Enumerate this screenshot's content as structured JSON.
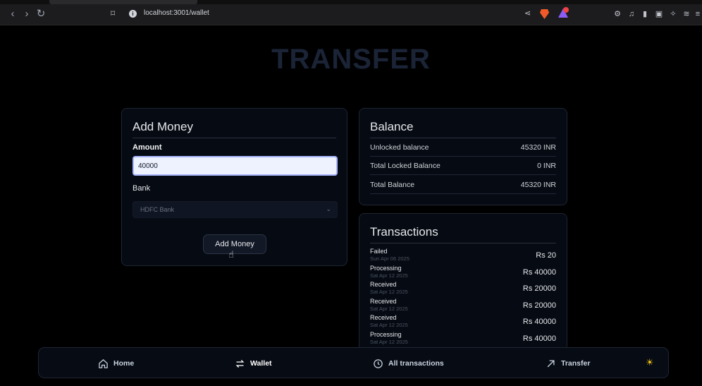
{
  "browser": {
    "url": "localhost:3001/wallet"
  },
  "page": {
    "title": "TRANSFER"
  },
  "add_money": {
    "title": "Add Money",
    "amount_label": "Amount",
    "amount_value": "40000",
    "bank_label": "Bank",
    "bank_selected": "HDFC Bank",
    "button_label": "Add Money"
  },
  "balance": {
    "title": "Balance",
    "rows": [
      {
        "label": "Unlocked balance",
        "value": "45320 INR"
      },
      {
        "label": "Total Locked Balance",
        "value": "0 INR"
      },
      {
        "label": "Total Balance",
        "value": "45320 INR"
      }
    ]
  },
  "transactions": {
    "title": "Transactions",
    "items": [
      {
        "status": "Failed",
        "date": "Sun Apr 06 2025",
        "amount": "Rs 20"
      },
      {
        "status": "Processing",
        "date": "Sat Apr 12 2025",
        "amount": "Rs 40000"
      },
      {
        "status": "Received",
        "date": "Sat Apr 12 2025",
        "amount": "Rs 20000"
      },
      {
        "status": "Received",
        "date": "Sat Apr 12 2025",
        "amount": "Rs 20000"
      },
      {
        "status": "Received",
        "date": "Sat Apr 12 2025",
        "amount": "Rs 40000"
      },
      {
        "status": "Processing",
        "date": "Sat Apr 12 2025",
        "amount": "Rs 40000"
      }
    ]
  },
  "bottom_nav": {
    "items": [
      {
        "label": "Home",
        "icon": "home-icon"
      },
      {
        "label": "Wallet",
        "icon": "transfer-arrows-icon",
        "active": true
      },
      {
        "label": "All transactions",
        "icon": "clock-icon"
      },
      {
        "label": "Transfer",
        "icon": "arrow-up-right-icon"
      }
    ],
    "theme_icon": "sun-icon"
  },
  "colors": {
    "background": "#000000",
    "card": "#060a12",
    "title_muted": "#1b2437",
    "input_bg": "#eef2ff"
  }
}
